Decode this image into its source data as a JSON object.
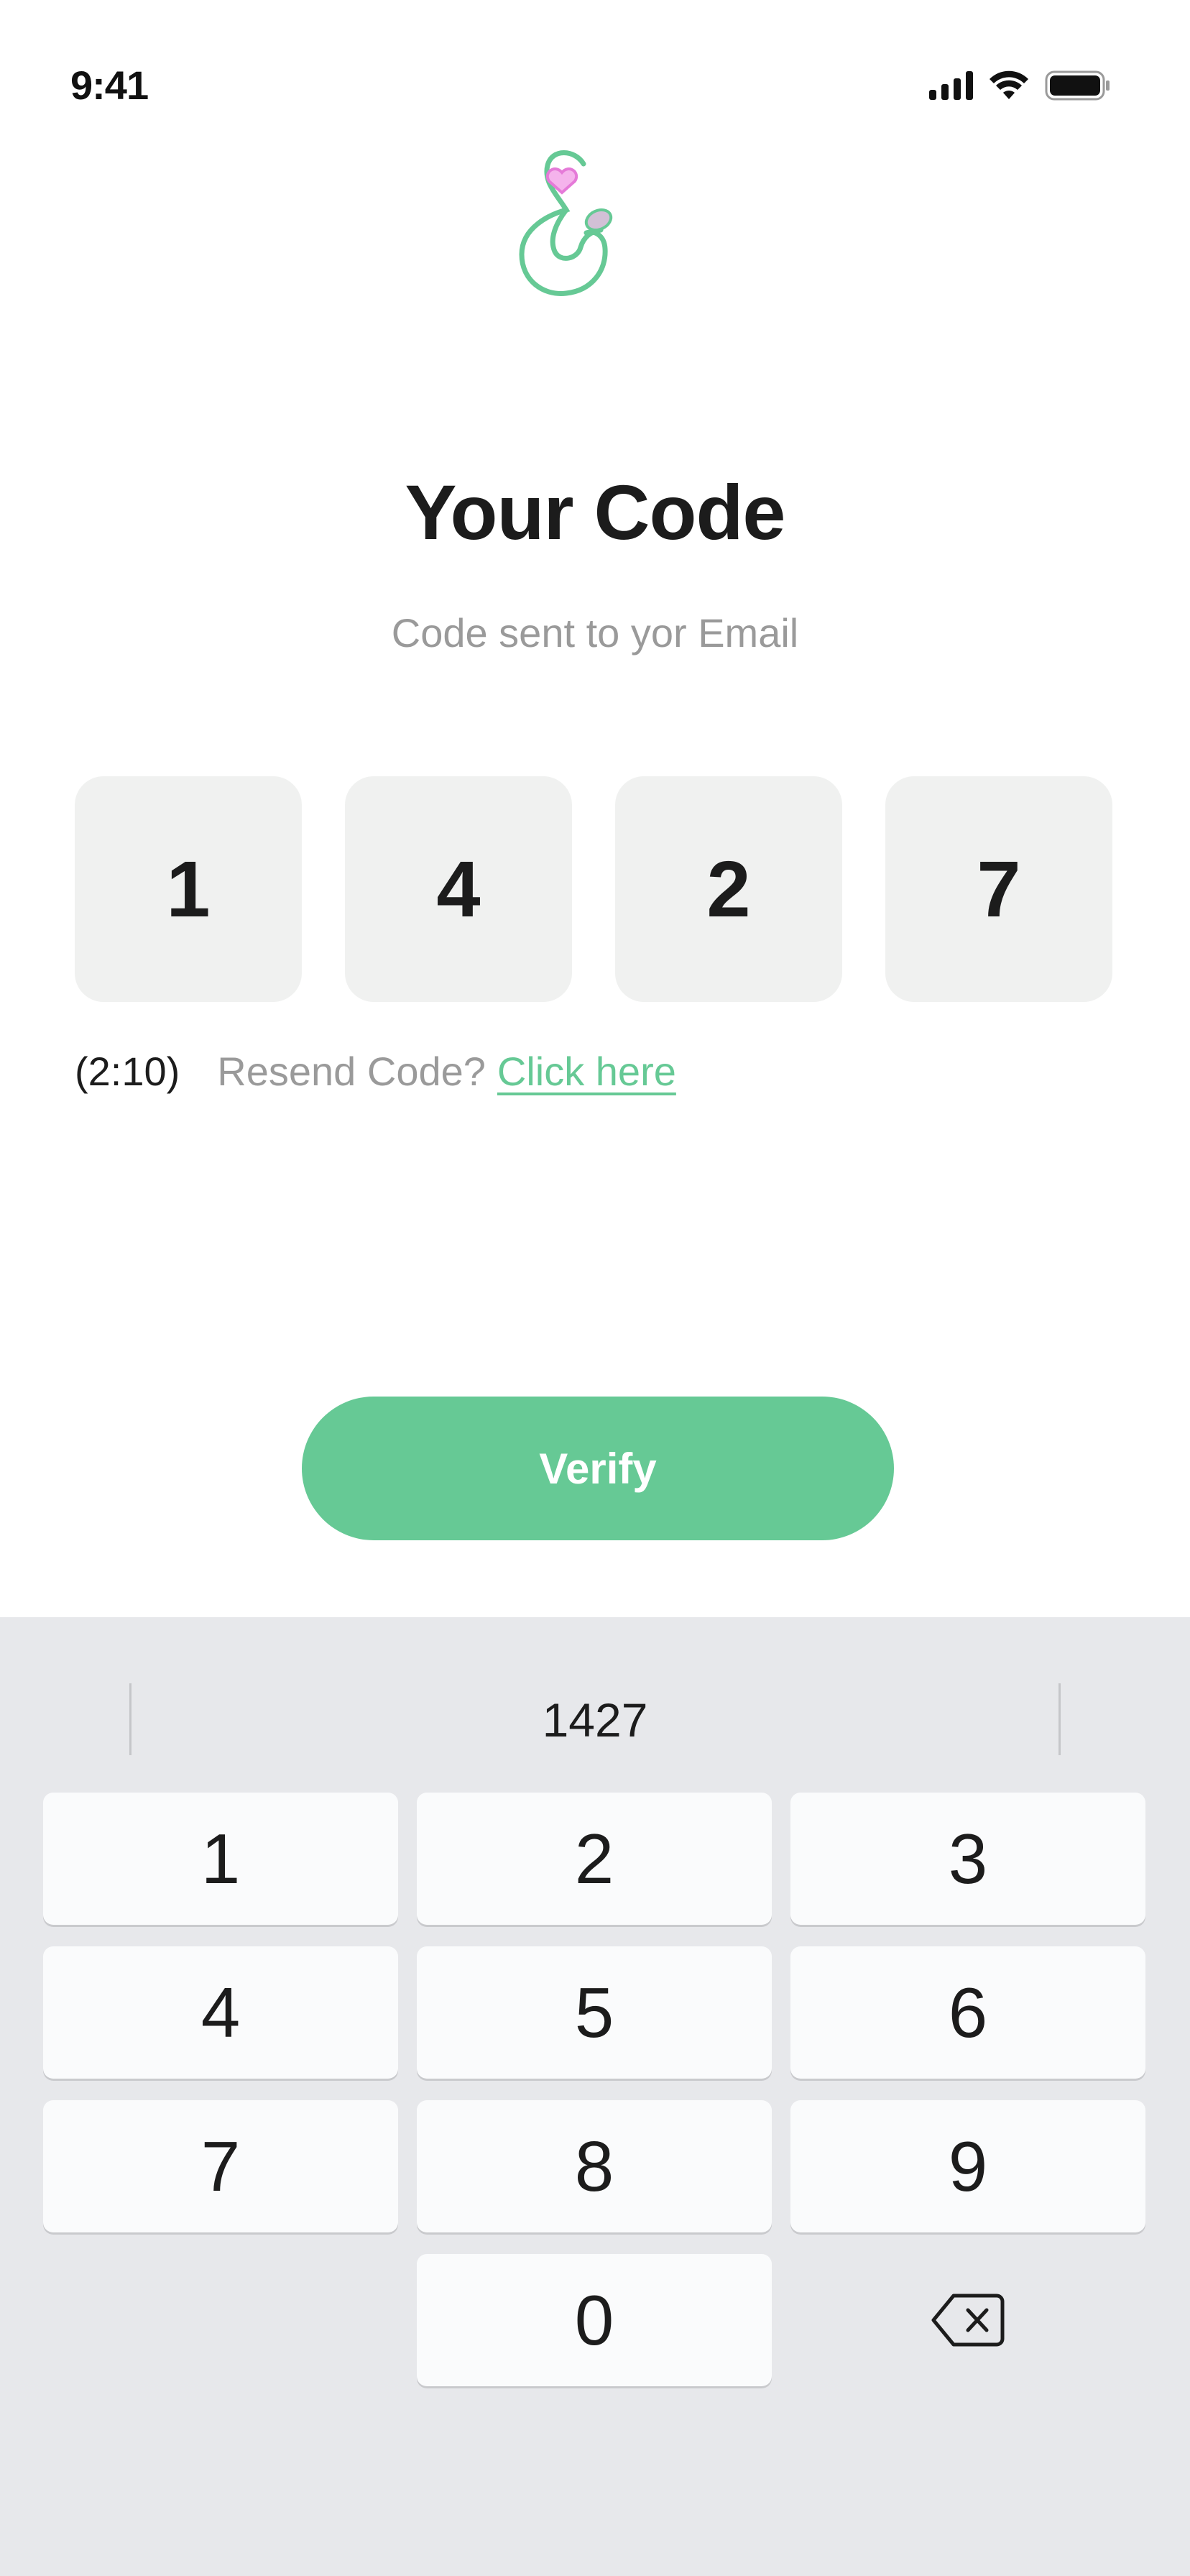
{
  "status_bar": {
    "time": "9:41",
    "icons": [
      "signal-icon",
      "wifi-icon",
      "battery-icon"
    ]
  },
  "logo": {
    "icon": "ampersand-heart-logo",
    "colors": {
      "stroke": "#66c995",
      "heart": "#f5a3e6"
    }
  },
  "header": {
    "title": "Your Code",
    "subtitle": "Code sent to yor Email"
  },
  "code": {
    "digits": [
      "1",
      "4",
      "2",
      "7"
    ]
  },
  "resend": {
    "timer": "(2:10)",
    "prompt": "Resend Code?",
    "link": "Click here"
  },
  "verify_button": {
    "label": "Verify"
  },
  "keyboard": {
    "suggestion": "1427",
    "keys": [
      "1",
      "2",
      "3",
      "4",
      "5",
      "6",
      "7",
      "8",
      "9",
      "0"
    ],
    "delete_icon": "backspace-icon"
  },
  "colors": {
    "accent": "#66c995",
    "code_box": "#f0f1f0",
    "keyboard_bg": "#e7e8eb",
    "muted_text": "#9a9a9a"
  }
}
